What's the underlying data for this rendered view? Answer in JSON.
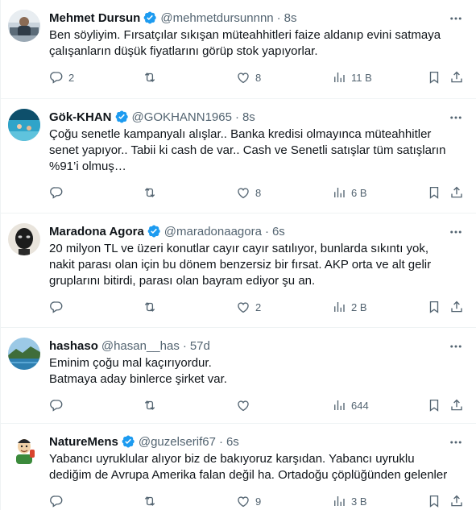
{
  "colors": {
    "verified": "#1d9bf0",
    "text": "#0f1419",
    "muted": "#536471",
    "border": "#eff3f4"
  },
  "tweets": [
    {
      "name": "Mehmet Dursun",
      "handle": "@mehmetdursunnnn",
      "time": "8s",
      "text": "Ben söyliyim. Fırsatçılar sıkışan müteahhitleri faize aldanıp evini satmaya\nçalışanların düşük fiyatlarını görüp stok yapıyorlar.",
      "replies": "2",
      "retweets": "",
      "likes": "8",
      "views": "11 B",
      "avatar_icon": "photo-avatar"
    },
    {
      "name": "Gök-KHAN",
      "handle": "@GOKHANN1965",
      "time": "8s",
      "text": "Çoğu senetle kampanyalı alışlar.. Banka kredisi olmayınca müteahhitler\nsenet yapıyor.. Tabii ki cash de var.. Cash ve Senetli satışlar tüm satışların\n%91’i olmuş…",
      "replies": "",
      "retweets": "",
      "likes": "8",
      "views": "6 B",
      "avatar_icon": "pool-avatar"
    },
    {
      "name": "Maradona Agora",
      "handle": "@maradonaagora",
      "time": "6s",
      "text": "20 milyon TL ve üzeri konutlar cayır cayır satılıyor, bunlarda sıkıntı yok,\nnakit parası olan için bu dönem benzersiz bir fırsat. AKP orta ve alt gelir\ngruplarını bitirdi, parası olan bayram ediyor şu an.",
      "replies": "",
      "retweets": "",
      "likes": "2",
      "views": "2 B",
      "avatar_icon": "mask-avatar"
    },
    {
      "name": "hashaso",
      "handle": "@hasan__has",
      "time": "57d",
      "text": "Eminim çoğu mal kaçırıyordur.\nBatmaya aday binlerce şirket var.",
      "replies": "",
      "retweets": "",
      "likes": "",
      "views": "644",
      "avatar_icon": "landscape-avatar"
    },
    {
      "name": "NatureMens",
      "handle": "@guzelserif67",
      "time": "6s",
      "text": "Yabancı uyruklular alıyor biz de bakıyoruz karşıdan. Yabancı uyruklu\ndediğim de Avrupa Amerika falan değil ha. Ortadoğu çöplüğünden gelenler",
      "replies": "",
      "retweets": "",
      "likes": "9",
      "views": "3 B",
      "avatar_icon": "cartoon-avatar"
    }
  ]
}
